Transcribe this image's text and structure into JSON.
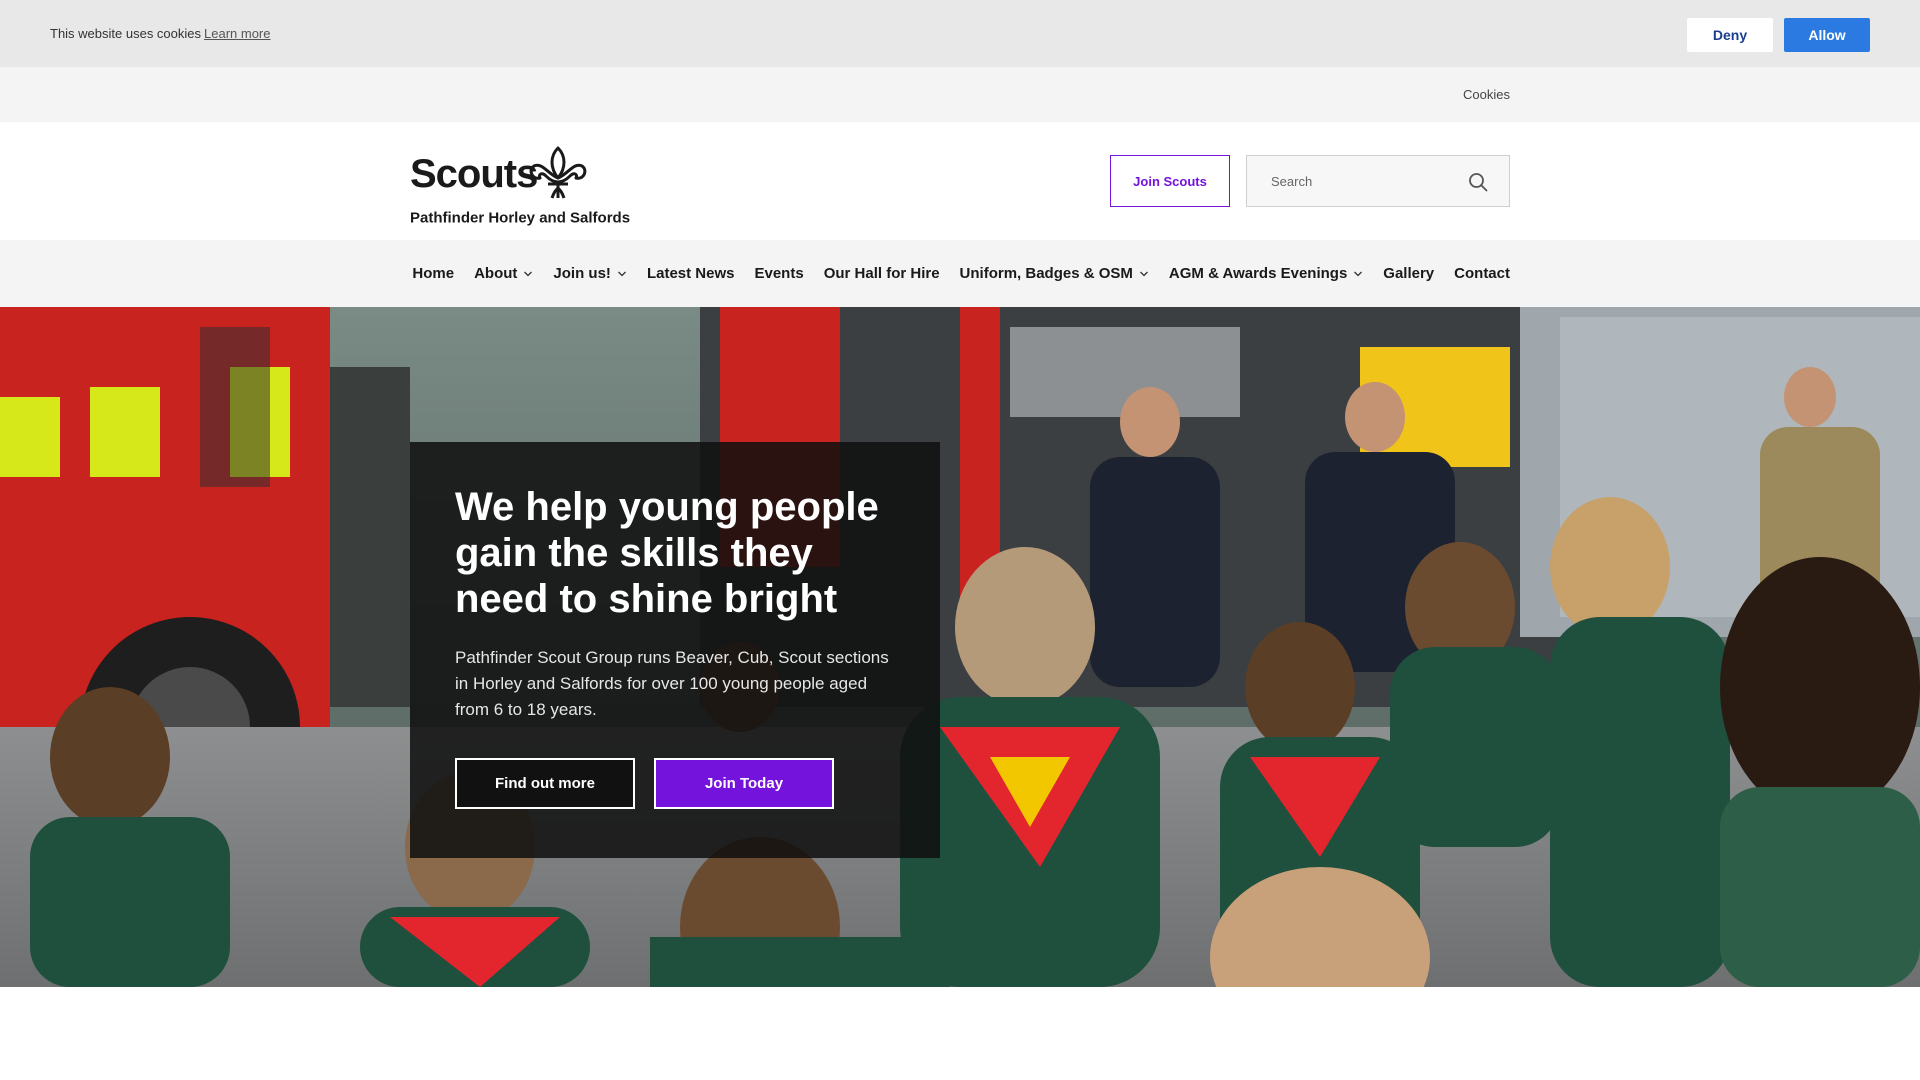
{
  "cookie_banner": {
    "text": "This website uses cookies",
    "learn_more": "Learn more",
    "deny": "Deny",
    "allow": "Allow"
  },
  "utility_bar": {
    "cookies_link": "Cookies"
  },
  "header": {
    "logo_word": "Scouts",
    "logo_icon": "fleur-de-lis-icon",
    "group_name": "Pathfinder Horley and Salfords",
    "join_button": "Join Scouts",
    "search_placeholder": "Search",
    "search_icon": "search-icon"
  },
  "nav": {
    "items": [
      {
        "label": "Home",
        "dropdown": false
      },
      {
        "label": "About",
        "dropdown": true
      },
      {
        "label": "Join us!",
        "dropdown": true
      },
      {
        "label": "Latest News",
        "dropdown": false
      },
      {
        "label": "Events",
        "dropdown": false
      },
      {
        "label": "Our Hall for Hire",
        "dropdown": false
      },
      {
        "label": "Uniform, Badges & OSM",
        "dropdown": true
      },
      {
        "label": "AGM & Awards Evenings",
        "dropdown": true
      },
      {
        "label": "Gallery",
        "dropdown": false
      },
      {
        "label": "Contact",
        "dropdown": false
      }
    ]
  },
  "hero": {
    "title": "We help young people gain the skills they need to shine bright",
    "description": "Pathfinder Scout Group runs Beaver, Cub, Scout sections in Horley and Salfords for over 100 young people aged from 6 to 18 years.",
    "find_out_more": "Find out more",
    "join_today": "Join Today"
  },
  "colors": {
    "brand_purple": "#7413dc",
    "allow_blue": "#2a7ae2",
    "scarf_red": "#e3262d",
    "scarf_yellow": "#f2c700",
    "uniform_green": "#1f4f3d"
  }
}
